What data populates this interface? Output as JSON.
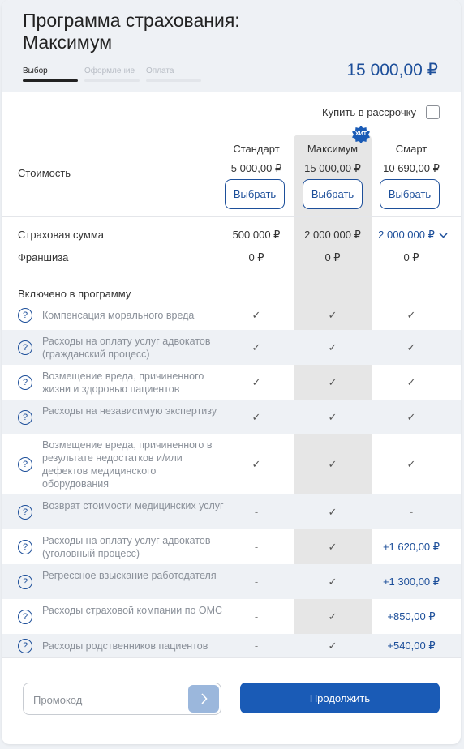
{
  "header": {
    "title_line1": "Программа страхования:",
    "title_line2": "Максимум",
    "steps": [
      "Выбор",
      "Оформление",
      "Оплата"
    ],
    "total": "15 000,00 ₽"
  },
  "installment_label": "Купить в рассрочку",
  "badge": "ХИТ",
  "cost_label": "Стоимость",
  "plans": [
    {
      "name": "Стандарт",
      "price": "5 000,00 ₽",
      "button": "Выбрать"
    },
    {
      "name": "Максимум",
      "price": "15 000,00 ₽",
      "button": "Выбрать"
    },
    {
      "name": "Смарт",
      "price": "10 690,00 ₽",
      "button": "Выбрать"
    }
  ],
  "sum_label": "Страховая сумма",
  "sum_values": [
    "500 000 ₽",
    "2 000 000 ₽",
    "2 000 000 ₽"
  ],
  "franchise_label": "Франшиза",
  "franchise_values": [
    "0 ₽",
    "0 ₽",
    "0 ₽"
  ],
  "section_title": "Включено в программу",
  "features": [
    {
      "label": "Компенсация морального вреда",
      "values": [
        "✓",
        "✓",
        "✓"
      ]
    },
    {
      "label": "Расходы на оплату услуг адвокатов (гражданский процесс)",
      "values": [
        "✓",
        "✓",
        "✓"
      ]
    },
    {
      "label": "Возмещение вреда, причиненного жизни и здоровью пациентов",
      "values": [
        "✓",
        "✓",
        "✓"
      ]
    },
    {
      "label": "Расходы на независимую экспертизу",
      "values": [
        "✓",
        "✓",
        "✓"
      ]
    },
    {
      "label": "Возмещение вреда, причиненного в результате недостатков и/или дефектов медицинского оборудования",
      "values": [
        "✓",
        "✓",
        "✓"
      ]
    },
    {
      "label": "Возврат стоимости медицинских услуг",
      "values": [
        "-",
        "✓",
        "-"
      ]
    },
    {
      "label": "Расходы на оплату услуг адвокатов (уголовный процесс)",
      "values": [
        "-",
        "✓",
        "+1 620,00 ₽"
      ]
    },
    {
      "label": "Регрессное взыскание работодателя",
      "values": [
        "-",
        "✓",
        "+1 300,00 ₽"
      ]
    },
    {
      "label": "Расходы страховой компании по ОМС",
      "values": [
        "-",
        "✓",
        "+850,00 ₽"
      ]
    },
    {
      "label": "Расходы родственников пациентов",
      "values": [
        "-",
        "✓",
        "+540,00 ₽"
      ]
    }
  ],
  "promo": {
    "placeholder": "Промокод"
  },
  "continue_label": "Продолжить",
  "colors": {
    "accent": "#1a5bb6",
    "price": "#1d4f9a",
    "highlight": "#e6e6e6"
  }
}
